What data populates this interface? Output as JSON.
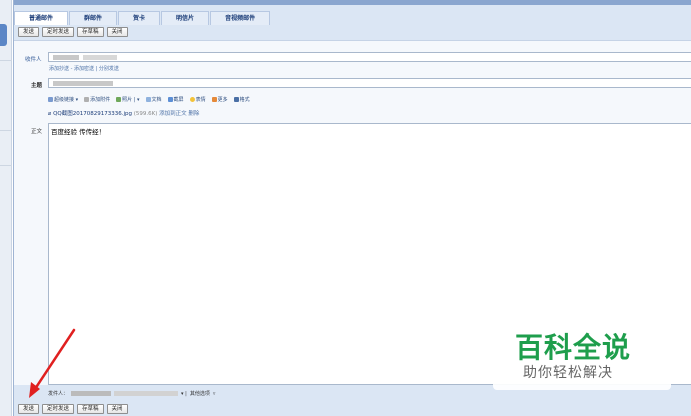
{
  "tabs": [
    {
      "label": "普通邮件",
      "active": true
    },
    {
      "label": "群邮件",
      "active": false
    },
    {
      "label": "贺卡",
      "active": false
    },
    {
      "label": "明信片",
      "active": false
    },
    {
      "label": "音视频邮件",
      "active": false
    }
  ],
  "toolbar": {
    "send": "发送",
    "scheduled_send": "定时发送",
    "save_draft": "存草稿",
    "close": "关闭"
  },
  "compose": {
    "to_label": "收件人",
    "add_cc": "添加抄送 - 添加密送 | 分别发送",
    "subject_label": "主题",
    "body_label": "正文",
    "body_text": "百度经验 传传经！",
    "editor_tools": [
      "超级链接",
      "添加附件",
      "照片",
      "文档",
      "截屏",
      "表情",
      "更多",
      "格式"
    ],
    "attachment_name": "QQ截图20170829173336.jpg",
    "attachment_size": "(599.6K)",
    "attachment_actions": "添加到正文  删除"
  },
  "footer": {
    "sender_label": "发件人：",
    "other_options": "其他选项"
  },
  "watermark": {
    "main": "百科全说",
    "sub": "助你轻松解决"
  },
  "colors": {
    "accent": "#1b3c78",
    "watermark_green": "#1e9e4c",
    "arrow_red": "#e02020"
  }
}
